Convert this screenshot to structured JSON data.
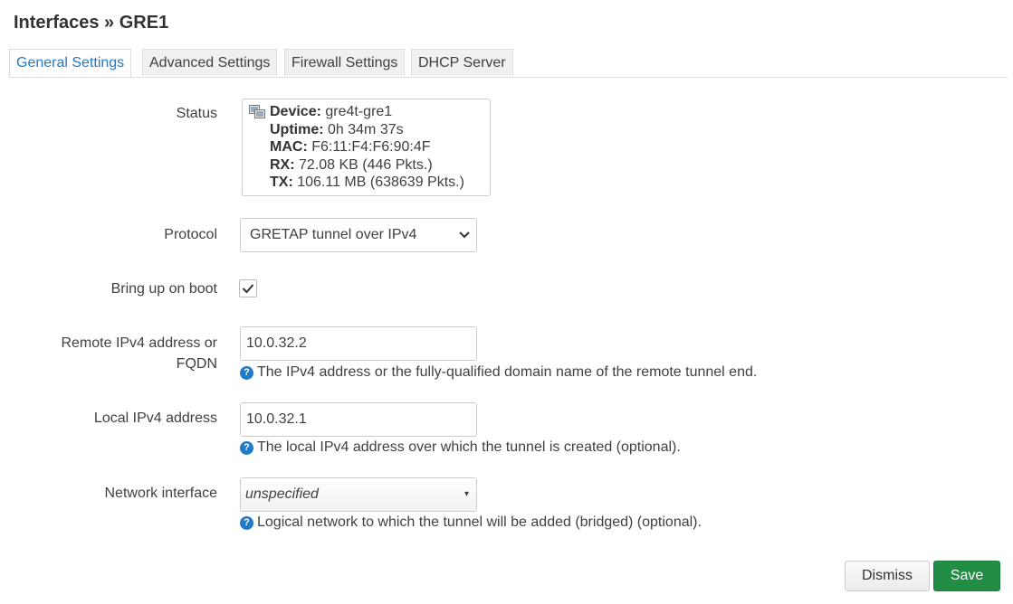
{
  "page": {
    "title": "Interfaces » GRE1"
  },
  "tabs": [
    {
      "label": "General Settings",
      "active": true
    },
    {
      "label": "Advanced Settings",
      "active": false
    },
    {
      "label": "Firewall Settings",
      "active": false
    },
    {
      "label": "DHCP Server",
      "active": false
    }
  ],
  "status": {
    "label": "Status",
    "device_key": "Device:",
    "device_val": "gre4t-gre1",
    "uptime_key": "Uptime:",
    "uptime_val": "0h 34m 37s",
    "mac_key": "MAC:",
    "mac_val": "F6:11:F4:F6:90:4F",
    "rx_key": "RX:",
    "rx_val": "72.08 KB (446 Pkts.)",
    "tx_key": "TX:",
    "tx_val": "106.11 MB (638639 Pkts.)"
  },
  "protocol": {
    "label": "Protocol",
    "value": "GRETAP tunnel over IPv4"
  },
  "boot": {
    "label": "Bring up on boot",
    "checked": true
  },
  "remote": {
    "label_line1": "Remote IPv4 address or",
    "label_line2": "FQDN",
    "value": "10.0.32.2",
    "help": "The IPv4 address or the fully-qualified domain name of the remote tunnel end."
  },
  "local": {
    "label": "Local IPv4 address",
    "value": "10.0.32.1",
    "help": "The local IPv4 address over which the tunnel is created (optional)."
  },
  "network": {
    "label": "Network interface",
    "value": "unspecified",
    "help": "Logical network to which the tunnel will be added (bridged) (optional)."
  },
  "help_glyph": "?",
  "caret_glyph": "▾",
  "buttons": {
    "dismiss": "Dismiss",
    "save": "Save"
  },
  "colors": {
    "accent": "#1f7ac9",
    "save": "#218d45"
  },
  "icons": [
    "network-device-icon",
    "chevron-down-icon",
    "checkmark-icon",
    "help-icon",
    "caret-down-icon"
  ]
}
